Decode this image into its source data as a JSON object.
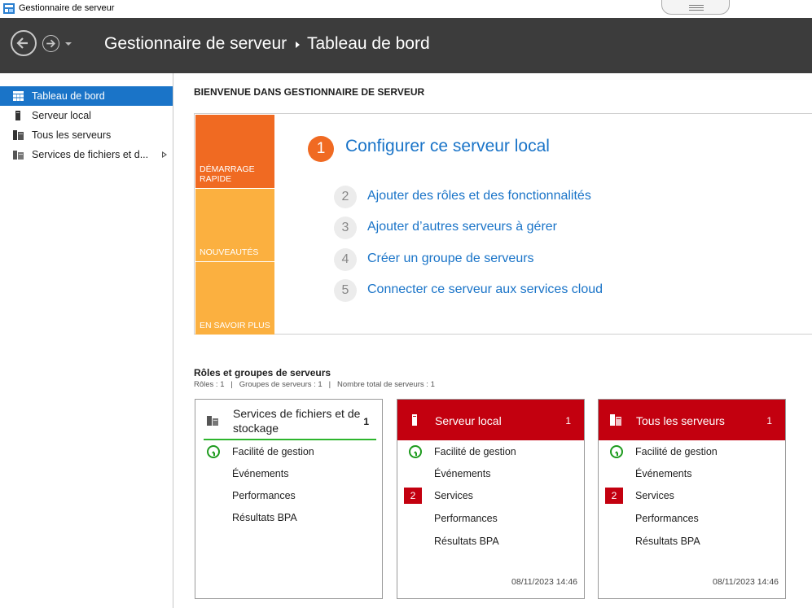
{
  "window": {
    "title": "Gestionnaire de serveur"
  },
  "header": {
    "breadcrumb": [
      "Gestionnaire de serveur",
      "Tableau de bord"
    ]
  },
  "sidebar": {
    "items": [
      {
        "label": "Tableau de bord",
        "icon": "dashboard-icon",
        "active": true
      },
      {
        "label": "Serveur local",
        "icon": "server-icon"
      },
      {
        "label": "Tous les serveurs",
        "icon": "servers-icon"
      },
      {
        "label": "Services de fichiers et d...",
        "icon": "file-services-icon"
      }
    ]
  },
  "main": {
    "welcome": "BIENVENUE DANS GESTIONNAIRE DE SERVEUR",
    "tiles": [
      "DÉMARRAGE RAPIDE",
      "NOUVEAUTÉS",
      "EN SAVOIR PLUS"
    ],
    "steps": [
      {
        "num": "1",
        "label": "Configurer ce serveur local"
      },
      {
        "num": "2",
        "label": "Ajouter des rôles et des fonctionnalités"
      },
      {
        "num": "3",
        "label": "Ajouter d’autres serveurs à gérer"
      },
      {
        "num": "4",
        "label": "Créer un groupe de serveurs"
      },
      {
        "num": "5",
        "label": "Connecter ce serveur aux services cloud"
      }
    ],
    "roles": {
      "title": "Rôles et groupes de serveurs",
      "subtitle": "Rôles : 1   |   Groupes de serveurs : 1   |   Nombre total de serveurs : 1"
    },
    "cards": [
      {
        "title": "Services de fichiers et de stockage",
        "count": "1",
        "rows": [
          "Facilité de gestion",
          "Événements",
          "Performances",
          "Résultats BPA"
        ],
        "timestamp": ""
      },
      {
        "title": "Serveur local",
        "count": "1",
        "rows": [
          "Facilité de gestion",
          "Événements",
          "Services",
          "Performances",
          "Résultats BPA"
        ],
        "services_badge": "2",
        "timestamp": "08/11/2023 14:46"
      },
      {
        "title": "Tous les serveurs",
        "count": "1",
        "rows": [
          "Facilité de gestion",
          "Événements",
          "Services",
          "Performances",
          "Résultats BPA"
        ],
        "services_badge": "2",
        "timestamp": "08/11/2023 14:46"
      }
    ]
  },
  "colors": {
    "header_bg": "#3c3c3c",
    "accent_blue": "#1a74c8",
    "quickstart_orange": "#f06a22",
    "tile_yellow": "#fbb040",
    "alert_red": "#c3000f",
    "ok_green": "#1e9b1e"
  }
}
